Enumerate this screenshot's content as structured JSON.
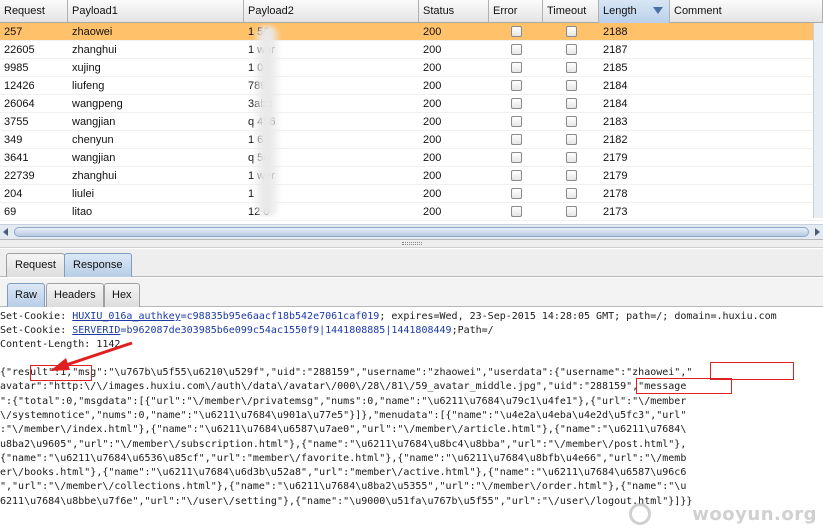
{
  "table": {
    "columns": [
      {
        "label": "Request",
        "w": 68
      },
      {
        "label": "Payload1",
        "w": 176
      },
      {
        "label": "Payload2",
        "w": 175
      },
      {
        "label": "Status",
        "w": 70
      },
      {
        "label": "Error",
        "w": 54
      },
      {
        "label": "Timeout",
        "w": 56
      },
      {
        "label": "Length",
        "w": 71
      },
      {
        "label": "Comment",
        "w": 153
      }
    ],
    "sorted_column": "Length",
    "selected_row_index": 0,
    "rows": [
      {
        "request": "257",
        "payload1": "zhaowei",
        "payload2": "1   56",
        "status": "200",
        "error": false,
        "timeout": false,
        "length": "2188"
      },
      {
        "request": "22605",
        "payload1": "zhanghui",
        "payload2": "1   wer",
        "status": "200",
        "error": false,
        "timeout": false,
        "length": "2187"
      },
      {
        "request": "9985",
        "payload1": "xujing",
        "payload2": "1   0",
        "status": "200",
        "error": false,
        "timeout": false,
        "length": "2185"
      },
      {
        "request": "12426",
        "payload1": "liufeng",
        "payload2": "   789",
        "status": "200",
        "error": false,
        "timeout": false,
        "length": "2184"
      },
      {
        "request": "26064",
        "payload1": "wangpeng",
        "payload2": "   3abc",
        "status": "200",
        "error": false,
        "timeout": false,
        "length": "2184"
      },
      {
        "request": "3755",
        "payload1": "wangjian",
        "payload2": "q   456",
        "status": "200",
        "error": false,
        "timeout": false,
        "length": "2183"
      },
      {
        "request": "349",
        "payload1": "chenyun",
        "payload2": "1   6",
        "status": "200",
        "error": false,
        "timeout": false,
        "length": "2182"
      },
      {
        "request": "3641",
        "payload1": "wangjian",
        "payload2": "q   56",
        "status": "200",
        "error": false,
        "timeout": false,
        "length": "2179"
      },
      {
        "request": "22739",
        "payload1": "zhanghui",
        "payload2": "1   wer",
        "status": "200",
        "error": false,
        "timeout": false,
        "length": "2179"
      },
      {
        "request": "204",
        "payload1": "liulei",
        "payload2": "1",
        "status": "200",
        "error": false,
        "timeout": false,
        "length": "2178"
      },
      {
        "request": "69",
        "payload1": "litao",
        "payload2": "12   6",
        "status": "200",
        "error": false,
        "timeout": false,
        "length": "2173"
      }
    ]
  },
  "tabs": {
    "request": "Request",
    "response": "Response",
    "active": "Response"
  },
  "subtabs": {
    "raw": "Raw",
    "headers": "Headers",
    "hex": "Hex",
    "active": "Raw"
  },
  "response": {
    "line1": {
      "prefix": "Set-Cookie: ",
      "key": "HUXIU_016a_authkey",
      "value": "=c98835b95e6aacf18b542e7061caf019",
      "rest": "; expires=Wed, 23-Sep-2015 14:28:05 GMT; path=/; domain=.huxiu.com"
    },
    "line2": {
      "prefix": "Set-Cookie: ",
      "key": "SERVERID",
      "value": "=b962087de303985b6e099c54ac1550f9|1441808885|1441808449",
      "rest": ";Path=/"
    },
    "line3": "Content-Length: 1142",
    "body": [
      "{\"result\":1,\"msg\":\"\\u767b\\u5f55\\u6210\\u529f\",\"uid\":\"288159\",\"username\":\"zhaowei\",\"userdata\":{\"username\":\"zhaowei\",\"",
      "avatar\":\"http:\\/\\/images.huxiu.com\\/auth\\/data\\/avatar\\/000\\/28\\/81\\/59_avatar_middle.jpg\",\"uid\":\"288159\",\"message",
      "\":{\"total\":0,\"msgdata\":[{\"url\":\"\\/member\\/privatemsg\",\"nums\":0,\"name\":\"\\u6211\\u7684\\u79c1\\u4fe1\"},{\"url\":\"\\/member",
      "\\/systemnotice\",\"nums\":0,\"name\":\"\\u6211\\u7684\\u901a\\u77e5\"}]},\"menudata\":[{\"name\":\"\\u4e2a\\u4eba\\u4e2d\\u5fc3\",\"url\"",
      ":\"\\/member\\/index.html\"},{\"name\":\"\\u6211\\u7684\\u6587\\u7ae0\",\"url\":\"\\/member\\/article.html\"},{\"name\":\"\\u6211\\u7684\\",
      "u8ba2\\u9605\",\"url\":\"\\/member\\/subscription.html\"},{\"name\":\"\\u6211\\u7684\\u8bc4\\u8bba\",\"url\":\"\\/member\\/post.html\"},",
      "{\"name\":\"\\u6211\\u7684\\u6536\\u85cf\",\"url\":\"member\\/favorite.html\"},{\"name\":\"\\u6211\\u7684\\u8bfb\\u4e66\",\"url\":\"\\/memb",
      "er\\/books.html\"},{\"name\":\"\\u6211\\u7684\\u6d3b\\u52a8\",\"url\":\"member\\/active.html\"},{\"name\":\"\\u6211\\u7684\\u6587\\u96c6",
      "\",\"url\":\"\\/member\\/collections.html\"},{\"name\":\"\\u6211\\u7684\\u8ba2\\u5355\",\"url\":\"\\/member\\/order.html\"},{\"name\":\"\\u",
      "6211\\u7684\\u8bbe\\u7f6e\",\"url\":\"\\/user\\/setting\"},{\"name\":\"\\u9000\\u51fa\\u767b\\u5f55\",\"url\":\"\\/user\\/logout.html\"}]}}"
    ]
  },
  "watermark": "wooyun.org",
  "colors": {
    "selected_row": "#ffc16a",
    "annotation": "#e02020",
    "cookie_key": "#1b3aa8"
  }
}
